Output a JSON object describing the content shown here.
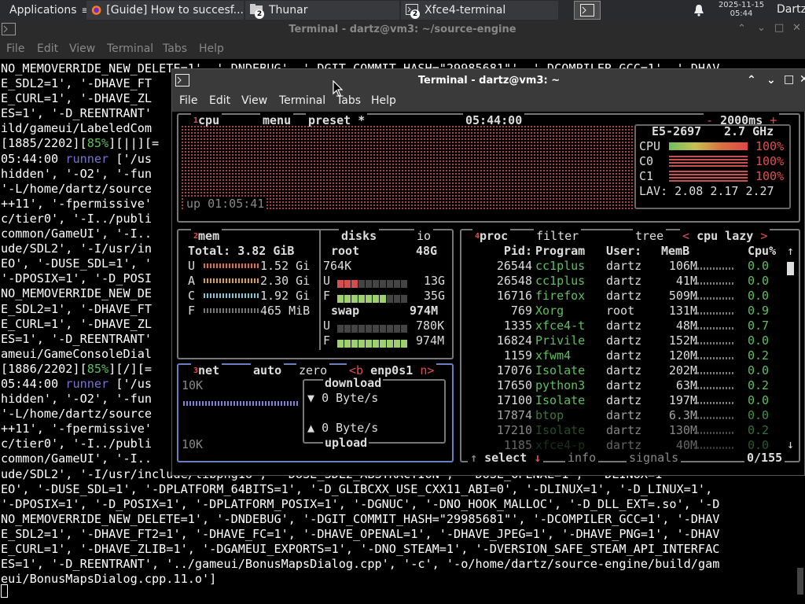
{
  "panel": {
    "applications": "Applications",
    "tasks": [
      {
        "label": "[Guide] How to succesf...",
        "icon": "firefox-icon"
      },
      {
        "label": "Thunar",
        "badge": "2",
        "icon": "folder-icon"
      },
      {
        "label": "Xfce4-terminal",
        "badge": "2",
        "icon": "terminal-icon"
      }
    ],
    "date": "2025-11-15",
    "time": "05:44",
    "user": "Dartz"
  },
  "back_window": {
    "title": "Terminal - dartz@vm3: ~/source-engine",
    "menu": [
      "File",
      "Edit",
      "View",
      "Terminal",
      "Tabs",
      "Help"
    ],
    "lines": [
      "NO_MEMOVERRIDE_NEW_DELETE=1', '-DNDEBUG', '-DGIT_COMMIT_HASH=\"29985681\"', '-DCOMPILER_GCC=1', '-DHAV",
      "E_SDL2=1', '-DHAVE_FT",
      "E_CURL=1', '-DHAVE_ZL",
      "ES=1', '-D_REENTRANT'",
      "ild/gameui/LabeledCom",
      "[1885/2202][85%][||][=",
      "05:44:00 runner ['/us",
      "hidden', '-O2', '-fun",
      "'-L/home/dartz/source",
      "++11', '-fpermissive'",
      "c/tier0', '-I../publi",
      "common/GameUI', '-I..",
      "ude/SDL2', '-I/usr/in",
      "EO', '-DUSE_SDL=1', '",
      "'-DPOSIX=1', '-D_POSI",
      "NO_MEMOVERRIDE_NEW_DE",
      "E_SDL2=1', '-DHAVE_FT",
      "E_CURL=1', '-DHAVE_ZL",
      "ES=1', '-D_REENTRANT'",
      "ameui/GameConsoleDial",
      "[1886/2202][85%][/][=",
      "05:44:00 runner ['/us",
      "hidden', '-O2', '-fun",
      "'-L/home/dartz/source",
      "++11', '-fpermissive'",
      "c/tier0', '-I../publi",
      "common/GameUI', '-I..",
      "ude/SDL2', '-I/usr/include/libpng16', '-DUSE_SDL2_ABSTRACTION', '-DUSE_OPENAL=1', '-DLINUX=1'",
      "EO', '-DUSE_SDL=1', '-DPLATFORM_64BITS=1', '-D_GLIBCXX_USE_CXX11_ABI=0', '-DLINUX=1', '-D_LINUX=1',",
      "'-DPOSIX=1', '-D_POSIX=1', '-DPLATFORM_POSIX=1', '-DGNUC', '-DNO_HOOK_MALLOC', '-D_DLL_EXT=.so', '-D",
      "NO_MEMOVERRIDE_NEW_DELETE=1', '-DNDEBUG', '-DGIT_COMMIT_HASH=\"29985681\"', '-DCOMPILER_GCC=1', '-DHAV",
      "E_SDL2=1', '-DHAVE_FT2=1', '-DHAVE_FC=1', '-DHAVE_OPENAL=1', '-DHAVE_JPEG=1', '-DHAVE_PNG=1', '-DHAV",
      "E_CURL=1', '-DHAVE_ZLIB=1', '-DGAMEUI_EXPORTS=1', '-DNO_STEAM=1', '-DVERSION_SAFE_STEAM_API_INTERFAC",
      "ES=1', '-D_REENTRANT', '../gameui/BonusMapsDialog.cpp', '-c', '-o/home/dartz/source-engine/build/gam",
      "eui/BonusMapsDialog.cpp.11.o']"
    ],
    "highlights": {
      "pct": "85%",
      "runner": "runner"
    }
  },
  "front_window": {
    "title": "Terminal - dartz@vm3: ~",
    "menu": [
      "File",
      "Edit",
      "View",
      "Terminal",
      "Tabs",
      "Help"
    ]
  },
  "btop": {
    "cpu": {
      "tab_num": "1",
      "tab": "cpu",
      "menu": "menu",
      "preset": "preset *",
      "clock": "05:44:00",
      "interval": "2000ms",
      "minus": "-",
      "plus": "+",
      "model": "E5-2697",
      "freq": "2.7 GHz",
      "rows": [
        {
          "label": "CPU",
          "pct": "100%"
        },
        {
          "label": "C0",
          "pct": "100%"
        },
        {
          "label": "C1",
          "pct": "100%"
        }
      ],
      "lav_label": "LAV:",
      "lav": [
        "2.08",
        "2.17",
        "2.27"
      ],
      "uptime": "up 01:05:41"
    },
    "mem": {
      "tab_num": "2",
      "tab": "mem",
      "total": "Total: 3.82 GiB",
      "rows": [
        {
          "label": "U",
          "value": "1.52 Gi"
        },
        {
          "label": "A",
          "value": "2.30 Gi"
        },
        {
          "label": "C",
          "value": "1.92 Gi"
        },
        {
          "label": "F",
          "value": "465 MiB"
        }
      ]
    },
    "disks": {
      "tab": "disks",
      "io": "io",
      "root_label": "root",
      "root_size": "48G",
      "root_io": "764K",
      "root_used_label": "U",
      "root_used": "13G",
      "root_used_pct": 27,
      "root_free_label": "F",
      "root_free": "35G",
      "root_free_pct": 73,
      "swap_label": "swap",
      "swap_size": "974M",
      "swap_used_label": "U",
      "swap_used": "780K",
      "swap_used_pct": 0,
      "swap_free_label": "F",
      "swap_free": "974M",
      "swap_free_pct": 100
    },
    "net": {
      "tab_num": "3",
      "tab": "net",
      "auto": "auto",
      "zero": "zero",
      "iface_prev": "<b",
      "iface": "enp0s1",
      "iface_next": "n>",
      "scale_top": "10K",
      "scale_bottom": "10K",
      "download": "download",
      "down_val": "0 Byte/s",
      "up_val": "0 Byte/s",
      "upload": "upload",
      "down_arrow": "▼",
      "up_arrow": "▲"
    },
    "proc": {
      "tab_num": "4",
      "tab": "proc",
      "filter": "filter",
      "tree": "tree",
      "sort_prev": "<",
      "sort": "cpu lazy",
      "sort_next": ">",
      "headers": [
        "Pid:",
        "Program",
        "User:",
        "MemB",
        "Cpu%"
      ],
      "rows": [
        {
          "pid": "26544",
          "program": "cc1plus",
          "user": "dartz",
          "mem": "106M",
          "cpu": "0.0"
        },
        {
          "pid": "26548",
          "program": "cc1plus",
          "user": "dartz",
          "mem": "41M",
          "cpu": "0.0"
        },
        {
          "pid": "16716",
          "program": "firefox",
          "user": "dartz",
          "mem": "509M",
          "cpu": "0.0"
        },
        {
          "pid": "769",
          "program": "Xorg",
          "user": "root",
          "mem": "131M",
          "cpu": "0.9"
        },
        {
          "pid": "1335",
          "program": "xfce4-t",
          "user": "dartz",
          "mem": "48M",
          "cpu": "0.7"
        },
        {
          "pid": "16824",
          "program": "Privile",
          "user": "dartz",
          "mem": "152M",
          "cpu": "0.0"
        },
        {
          "pid": "1159",
          "program": "xfwm4",
          "user": "dartz",
          "mem": "120M",
          "cpu": "0.2"
        },
        {
          "pid": "17076",
          "program": "Isolate",
          "user": "dartz",
          "mem": "202M",
          "cpu": "0.0"
        },
        {
          "pid": "17650",
          "program": "python3",
          "user": "dartz",
          "mem": "63M",
          "cpu": "0.2"
        },
        {
          "pid": "17100",
          "program": "Isolate",
          "user": "dartz",
          "mem": "197M",
          "cpu": "0.0"
        },
        {
          "pid": "17874",
          "program": "btop",
          "user": "dartz",
          "mem": "6.3M",
          "cpu": "0.0"
        },
        {
          "pid": "17210",
          "program": "Isolate",
          "user": "dartz",
          "mem": "130M",
          "cpu": "0.2"
        },
        {
          "pid": "1185",
          "program": "xfce4-p",
          "user": "dartz",
          "mem": "40M",
          "cpu": "0.0"
        }
      ],
      "footer_select": "select",
      "footer_info": "info",
      "footer_signals": "signals",
      "count": "0/155"
    }
  },
  "colors": {
    "green": "#5fbf5f",
    "red": "#e05050",
    "grey_border": "#777777"
  }
}
